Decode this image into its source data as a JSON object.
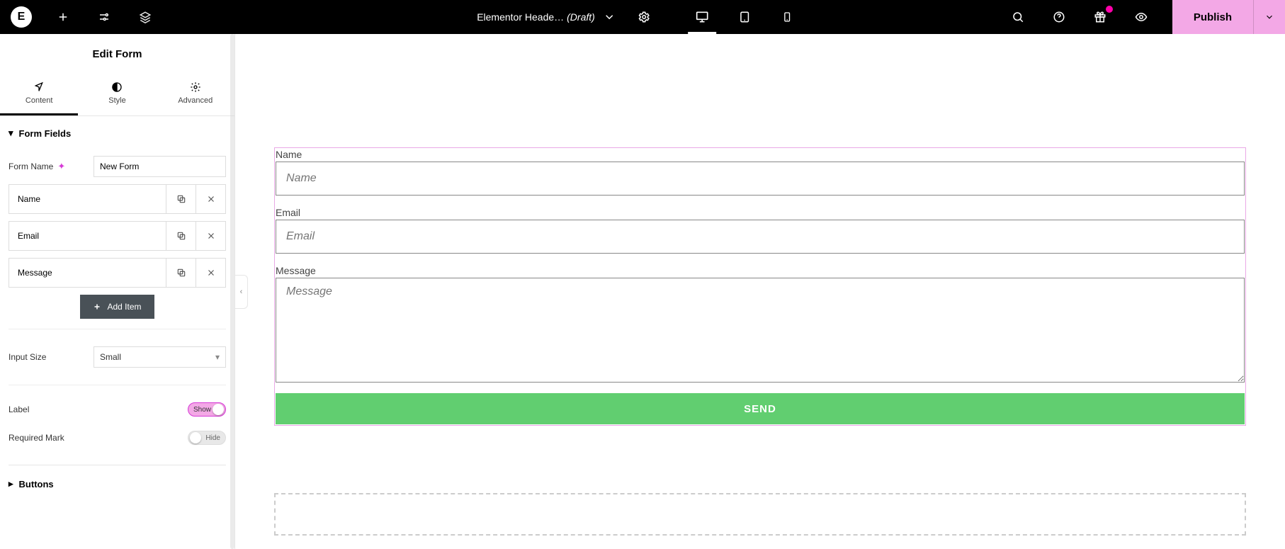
{
  "topbar": {
    "title": "Elementor Heade…",
    "draft": "(Draft)",
    "publish": "Publish"
  },
  "sidebar": {
    "head": "Edit Form",
    "tabs": {
      "content": "Content",
      "style": "Style",
      "advanced": "Advanced"
    },
    "section_form_fields": "Form Fields",
    "form_name_label": "Form Name",
    "form_name_value": "New Form",
    "items": [
      {
        "label": "Name"
      },
      {
        "label": "Email"
      },
      {
        "label": "Message"
      }
    ],
    "add_item": "Add Item",
    "input_size_label": "Input Size",
    "input_size_value": "Small",
    "label_label": "Label",
    "label_toggle": "Show",
    "required_label": "Required Mark",
    "required_toggle": "Hide",
    "section_buttons": "Buttons"
  },
  "canvas": {
    "fields": [
      {
        "label": "Name",
        "placeholder": "Name"
      },
      {
        "label": "Email",
        "placeholder": "Email"
      },
      {
        "label": "Message",
        "placeholder": "Message"
      }
    ],
    "send": "SEND"
  }
}
